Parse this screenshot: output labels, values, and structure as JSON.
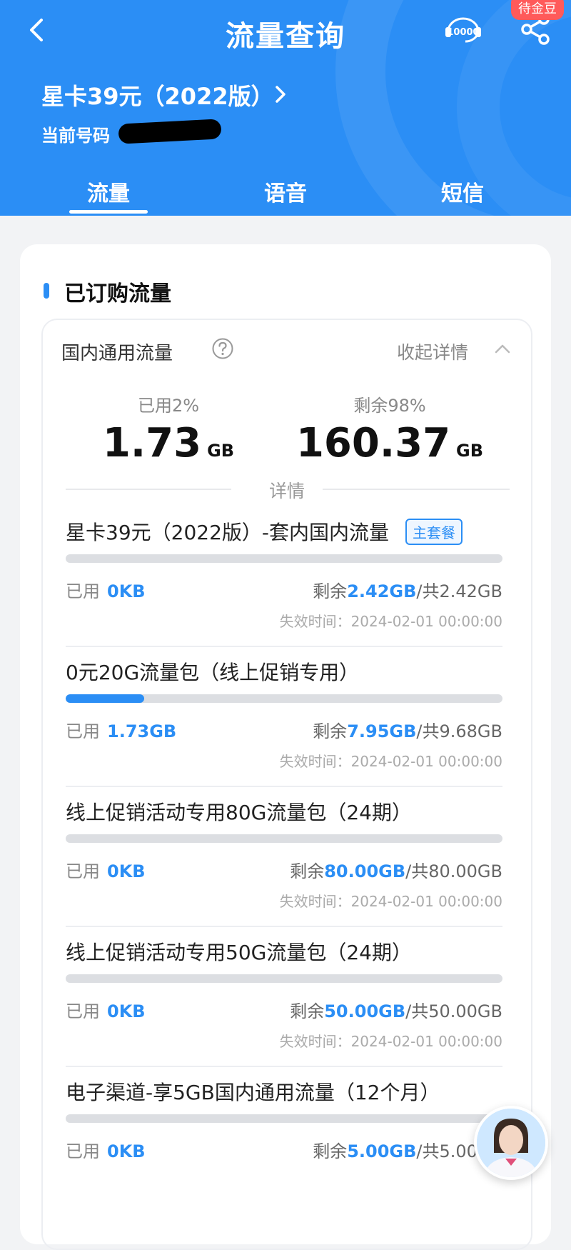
{
  "header": {
    "title": "流量查询",
    "coin_badge": "待金豆",
    "service_icon_text": "10000",
    "plan_name": "星卡39元（2022版）",
    "phone_label": "当前号码"
  },
  "tabs": [
    {
      "label": "流量",
      "active": true
    },
    {
      "label": "语音",
      "active": false
    },
    {
      "label": "短信",
      "active": false
    }
  ],
  "section": {
    "title": "已订购流量",
    "block_title": "国内通用流量",
    "collapse_label": "收起详情",
    "used_label": "已用2%",
    "used_value": "1.73",
    "used_unit": "GB",
    "remain_label": "剩余98%",
    "remain_value": "160.37",
    "remain_unit": "GB",
    "detail_label": "详情"
  },
  "packages": [
    {
      "name": "星卡39元（2022版）-套内国内流量",
      "badge": "主套餐",
      "used_prefix": "已用",
      "used": "0KB",
      "remain_prefix": "剩余",
      "remain": "2.42GB",
      "total": "/共2.42GB",
      "expire": "失效时间：2024-02-01 00:00:00",
      "progress": 0
    },
    {
      "name": "0元20G流量包（线上促销专用）",
      "badge": "",
      "used_prefix": "已用",
      "used": "1.73GB",
      "remain_prefix": "剩余",
      "remain": "7.95GB",
      "total": "/共9.68GB",
      "expire": "失效时间：2024-02-01 00:00:00",
      "progress": 0.18
    },
    {
      "name": "线上促销活动专用80G流量包（24期）",
      "badge": "",
      "used_prefix": "已用",
      "used": "0KB",
      "remain_prefix": "剩余",
      "remain": "80.00GB",
      "total": "/共80.00GB",
      "expire": "失效时间：2024-02-01 00:00:00",
      "progress": 0
    },
    {
      "name": "线上促销活动专用50G流量包（24期）",
      "badge": "",
      "used_prefix": "已用",
      "used": "0KB",
      "remain_prefix": "剩余",
      "remain": "50.00GB",
      "total": "/共50.00GB",
      "expire": "失效时间：2024-02-01 00:00:00",
      "progress": 0
    },
    {
      "name": "电子渠道-享5GB国内通用流量（12个月）",
      "badge": "",
      "used_prefix": "已用",
      "used": "0KB",
      "remain_prefix": "剩余",
      "remain": "5.00GB",
      "total": "/共5.00GB",
      "expire": "",
      "progress": 0
    }
  ],
  "colors": {
    "accent": "#2b8ef5",
    "badge_red": "#ff5a5a"
  }
}
